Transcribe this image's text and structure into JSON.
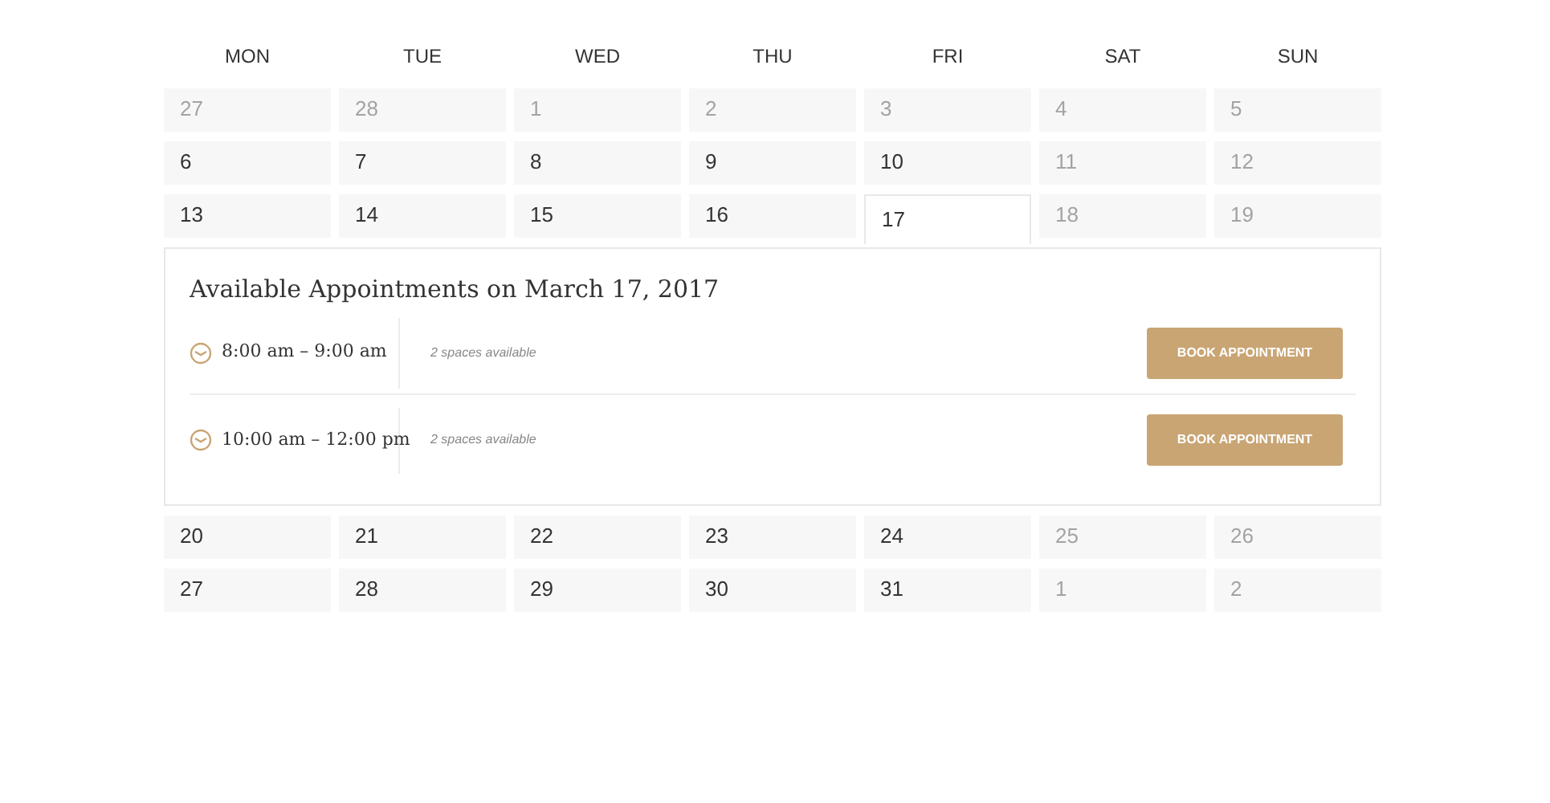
{
  "weekdays": [
    "MON",
    "TUE",
    "WED",
    "THU",
    "FRI",
    "SAT",
    "SUN"
  ],
  "weeks": [
    {
      "days": [
        {
          "label": "27",
          "disabled": true,
          "selected": false
        },
        {
          "label": "28",
          "disabled": true,
          "selected": false
        },
        {
          "label": "1",
          "disabled": true,
          "selected": false
        },
        {
          "label": "2",
          "disabled": true,
          "selected": false
        },
        {
          "label": "3",
          "disabled": true,
          "selected": false
        },
        {
          "label": "4",
          "disabled": true,
          "selected": false
        },
        {
          "label": "5",
          "disabled": true,
          "selected": false
        }
      ]
    },
    {
      "days": [
        {
          "label": "6",
          "disabled": false,
          "selected": false
        },
        {
          "label": "7",
          "disabled": false,
          "selected": false
        },
        {
          "label": "8",
          "disabled": false,
          "selected": false
        },
        {
          "label": "9",
          "disabled": false,
          "selected": false
        },
        {
          "label": "10",
          "disabled": false,
          "selected": false
        },
        {
          "label": "11",
          "disabled": true,
          "selected": false
        },
        {
          "label": "12",
          "disabled": true,
          "selected": false
        }
      ]
    },
    {
      "days": [
        {
          "label": "13",
          "disabled": false,
          "selected": false
        },
        {
          "label": "14",
          "disabled": false,
          "selected": false
        },
        {
          "label": "15",
          "disabled": false,
          "selected": false
        },
        {
          "label": "16",
          "disabled": false,
          "selected": false
        },
        {
          "label": "17",
          "disabled": false,
          "selected": true
        },
        {
          "label": "18",
          "disabled": true,
          "selected": false
        },
        {
          "label": "19",
          "disabled": true,
          "selected": false
        }
      ]
    },
    {
      "days": [
        {
          "label": "20",
          "disabled": false,
          "selected": false
        },
        {
          "label": "21",
          "disabled": false,
          "selected": false
        },
        {
          "label": "22",
          "disabled": false,
          "selected": false
        },
        {
          "label": "23",
          "disabled": false,
          "selected": false
        },
        {
          "label": "24",
          "disabled": false,
          "selected": false
        },
        {
          "label": "25",
          "disabled": true,
          "selected": false
        },
        {
          "label": "26",
          "disabled": true,
          "selected": false
        }
      ]
    },
    {
      "days": [
        {
          "label": "27",
          "disabled": false,
          "selected": false
        },
        {
          "label": "28",
          "disabled": false,
          "selected": false
        },
        {
          "label": "29",
          "disabled": false,
          "selected": false
        },
        {
          "label": "30",
          "disabled": false,
          "selected": false
        },
        {
          "label": "31",
          "disabled": false,
          "selected": false
        },
        {
          "label": "1",
          "disabled": true,
          "selected": false
        },
        {
          "label": "2",
          "disabled": true,
          "selected": false
        }
      ]
    }
  ],
  "appointments": {
    "title": "Available Appointments on March 17, 2017",
    "slots": [
      {
        "time": "8:00 am – 9:00 am",
        "spaces": "2 spaces available",
        "button": "BOOK APPOINTMENT"
      },
      {
        "time": "10:00 am – 12:00 pm",
        "spaces": "2 spaces available",
        "button": "BOOK APPOINTMENT"
      }
    ]
  }
}
